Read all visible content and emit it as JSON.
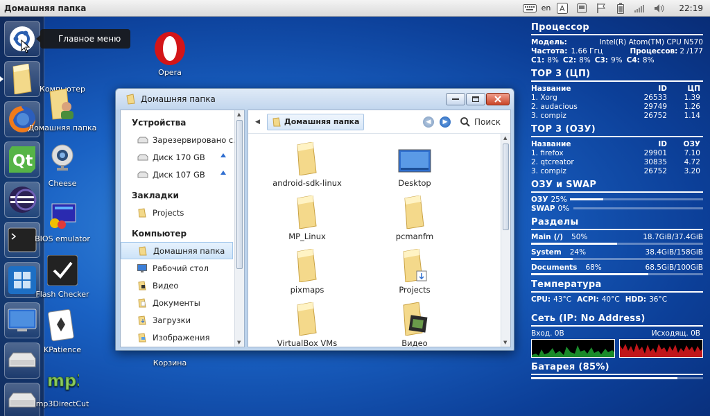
{
  "top_panel": {
    "title": "Домашняя папка",
    "keyboard_layout": "en",
    "clock": "22:19",
    "tray_icons": [
      "keyboard-icon",
      "font-icon",
      "device-icon",
      "flag-icon",
      "battery-icon",
      "signal-icon",
      "volume-icon"
    ]
  },
  "launcher": {
    "tooltip": "Главное меню",
    "items": [
      "ubuntu-logo",
      "home-folder",
      "firefox",
      "qt-creator",
      "eclipse",
      "terminal",
      "workspaces",
      "desktop",
      "drive-1",
      "drive-2"
    ]
  },
  "desktop_icons": [
    {
      "label": "Компьютер",
      "icon": "computer-icon"
    },
    {
      "label": "Opera",
      "icon": "opera-icon"
    },
    {
      "label": "Домашняя папка",
      "icon": "home-folder-icon"
    },
    {
      "label": "Cheese",
      "icon": "webcam-icon"
    },
    {
      "label": "BIOS emulator",
      "icon": "bios-emulator-icon"
    },
    {
      "label": "Flash Checker",
      "icon": "checkmark-icon"
    },
    {
      "label": "KPatience",
      "icon": "cards-icon"
    },
    {
      "label": "mp3DirectCut",
      "icon": "mp3-icon"
    },
    {
      "label": "Корзина",
      "icon": "trash-icon"
    }
  ],
  "window": {
    "title": "Домашняя папка",
    "sidebar": {
      "devices_heading": "Устройства",
      "devices": [
        {
          "label": "Зарезервировано с…",
          "eject": false
        },
        {
          "label": "Диск 170 GB",
          "eject": true
        },
        {
          "label": "Диск 107 GB",
          "eject": true
        }
      ],
      "bookmarks_heading": "Закладки",
      "bookmarks": [
        {
          "label": "Projects"
        }
      ],
      "computer_heading": "Компьютер",
      "places": [
        {
          "label": "Домашняя папка",
          "selected": true
        },
        {
          "label": "Рабочий стол"
        },
        {
          "label": "Видео"
        },
        {
          "label": "Документы"
        },
        {
          "label": "Загрузки"
        },
        {
          "label": "Изображения"
        }
      ]
    },
    "breadcrumb": "Домашняя папка",
    "search_label": "Поиск",
    "files": [
      {
        "name": "android-sdk-linux",
        "icon": "folder"
      },
      {
        "name": "Desktop",
        "icon": "desktop"
      },
      {
        "name": "MP_Linux",
        "icon": "folder"
      },
      {
        "name": "pcmanfm",
        "icon": "folder"
      },
      {
        "name": "pixmaps",
        "icon": "folder"
      },
      {
        "name": "Projects",
        "icon": "folder-download"
      },
      {
        "name": "VirtualBox VMs",
        "icon": "folder"
      },
      {
        "name": "Видео",
        "icon": "folder-video"
      }
    ]
  },
  "conky": {
    "cpu_heading": "Процессор",
    "model_label": "Модель:",
    "model_value": "Intel(R) Atom(TM) CPU N570",
    "freq_label": "Частота:",
    "freq_value": "1.66 Ггц",
    "procs_label": "Процессов:",
    "procs_value": "2 /177",
    "c1_label": "C1:",
    "c1": "8%",
    "c2_label": "C2:",
    "c2": "8%",
    "c3_label": "C3:",
    "c3": "9%",
    "c4_label": "C4:",
    "c4": "8%",
    "top_cpu_heading": "TOP 3 (ЦП)",
    "top_cpu_cols": [
      "Название",
      "ID",
      "ЦП"
    ],
    "top_cpu": [
      [
        "1. Xorg",
        "26533",
        "1.39"
      ],
      [
        "2. audacious",
        "29749",
        "1.26"
      ],
      [
        "3. compiz",
        "26752",
        "1.14"
      ]
    ],
    "top_mem_heading": "TOP 3 (ОЗУ)",
    "top_mem_cols": [
      "Название",
      "ID",
      "ОЗУ"
    ],
    "top_mem": [
      [
        "1. firefox",
        "29901",
        "7.10"
      ],
      [
        "2. qtcreator",
        "30835",
        "4.72"
      ],
      [
        "3. compiz",
        "26752",
        "3.20"
      ]
    ],
    "mem_heading": "ОЗУ и SWAP",
    "ram_label": "ОЗУ",
    "ram_value": "25%",
    "ram_fraction": 0.25,
    "swap_label": "SWAP",
    "swap_value": "0%",
    "swap_fraction": 0.0,
    "disk_heading": "Разделы",
    "disks": [
      {
        "name": "Main",
        "mount": "(/)",
        "percent": "50%",
        "usage": "18.7GiB/37.4GiB",
        "fraction": 0.5
      },
      {
        "name": "System",
        "mount": "",
        "percent": "24%",
        "usage": "38.4GiB/158GiB",
        "fraction": 0.24
      },
      {
        "name": "Documents",
        "mount": "",
        "percent": "68%",
        "usage": "68.5GiB/100GiB",
        "fraction": 0.68
      }
    ],
    "temp_heading": "Температура",
    "cpu_temp_label": "CPU:",
    "cpu_temp": "43°C",
    "acpi_temp_label": "ACPI:",
    "acpi_temp": "40°C",
    "hdd_temp_label": "HDD:",
    "hdd_temp": "36°C",
    "net_heading": "Сеть (IP: No Address)",
    "net_in": "Вход. 0B",
    "net_out": "Исходящ. 0B",
    "battery_heading": "Батарея (85%)",
    "battery_fraction": 0.85
  }
}
